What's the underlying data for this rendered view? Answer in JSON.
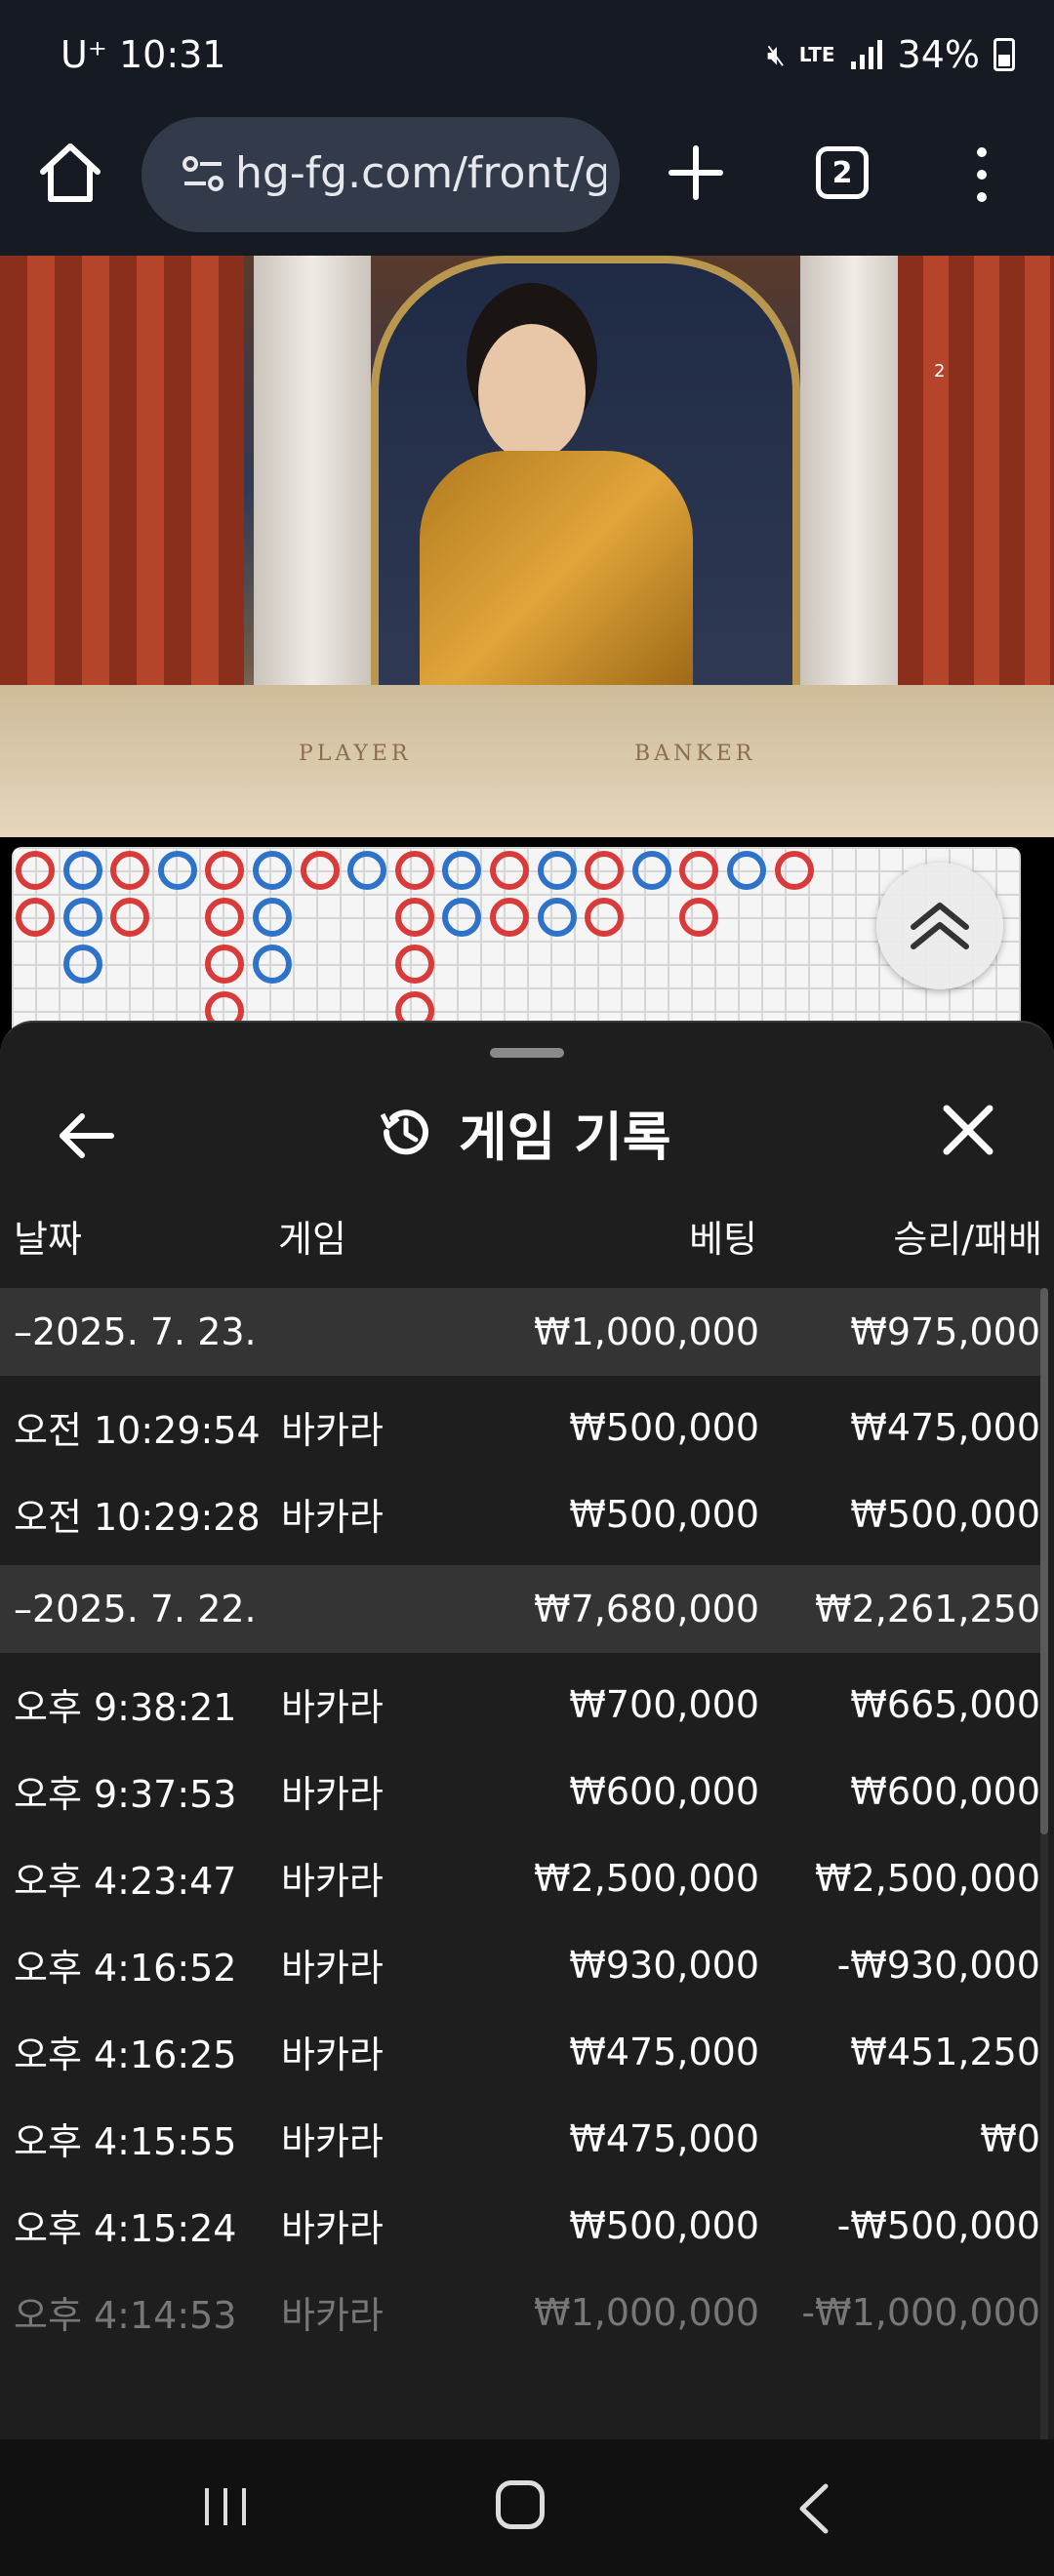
{
  "status_bar": {
    "carrier": "U⁺",
    "time": "10:31",
    "network": "LTE",
    "battery": "34%"
  },
  "browser": {
    "url": "hg-fg.com/front/g",
    "tab_count": "2"
  },
  "video": {
    "player_label": "PLAYER",
    "banker_label": "BANKER",
    "tag": "2"
  },
  "roadmap": {
    "beads": [
      {
        "col": 0,
        "row": 0,
        "color": "red"
      },
      {
        "col": 1,
        "row": 0,
        "color": "blue"
      },
      {
        "col": 2,
        "row": 0,
        "color": "red"
      },
      {
        "col": 3,
        "row": 0,
        "color": "blue"
      },
      {
        "col": 4,
        "row": 0,
        "color": "red"
      },
      {
        "col": 5,
        "row": 0,
        "color": "blue"
      },
      {
        "col": 6,
        "row": 0,
        "color": "red"
      },
      {
        "col": 7,
        "row": 0,
        "color": "blue"
      },
      {
        "col": 8,
        "row": 0,
        "color": "red"
      },
      {
        "col": 9,
        "row": 0,
        "color": "blue"
      },
      {
        "col": 10,
        "row": 0,
        "color": "red"
      },
      {
        "col": 11,
        "row": 0,
        "color": "blue"
      },
      {
        "col": 12,
        "row": 0,
        "color": "red"
      },
      {
        "col": 13,
        "row": 0,
        "color": "blue"
      },
      {
        "col": 14,
        "row": 0,
        "color": "red"
      },
      {
        "col": 15,
        "row": 0,
        "color": "blue"
      },
      {
        "col": 16,
        "row": 0,
        "color": "red"
      },
      {
        "col": 0,
        "row": 1,
        "color": "red"
      },
      {
        "col": 1,
        "row": 1,
        "color": "blue"
      },
      {
        "col": 2,
        "row": 1,
        "color": "red"
      },
      {
        "col": 4,
        "row": 1,
        "color": "red"
      },
      {
        "col": 5,
        "row": 1,
        "color": "blue"
      },
      {
        "col": 8,
        "row": 1,
        "color": "red"
      },
      {
        "col": 9,
        "row": 1,
        "color": "blue"
      },
      {
        "col": 10,
        "row": 1,
        "color": "red"
      },
      {
        "col": 11,
        "row": 1,
        "color": "blue"
      },
      {
        "col": 12,
        "row": 1,
        "color": "red"
      },
      {
        "col": 14,
        "row": 1,
        "color": "red"
      },
      {
        "col": 1,
        "row": 2,
        "color": "blue"
      },
      {
        "col": 4,
        "row": 2,
        "color": "red"
      },
      {
        "col": 5,
        "row": 2,
        "color": "blue"
      },
      {
        "col": 8,
        "row": 2,
        "color": "red"
      },
      {
        "col": 4,
        "row": 3,
        "color": "red"
      },
      {
        "col": 8,
        "row": 3,
        "color": "red"
      }
    ]
  },
  "sheet": {
    "title": "게임 기록",
    "columns": {
      "date": "날짜",
      "game": "게임",
      "bet": "베팅",
      "win_loss": "승리/패배"
    },
    "groups": [
      {
        "date": "–2025. 7. 23.",
        "bet": "₩1,000,000",
        "win_loss": "₩975,000",
        "rows": [
          {
            "time": "오전 10:29:54",
            "game": "바카라",
            "bet": "₩500,000",
            "win_loss": "₩475,000"
          },
          {
            "time": "오전 10:29:28",
            "game": "바카라",
            "bet": "₩500,000",
            "win_loss": "₩500,000"
          }
        ]
      },
      {
        "date": "–2025. 7. 22.",
        "bet": "₩7,680,000",
        "win_loss": "₩2,261,250",
        "rows": [
          {
            "time": "오후 9:38:21",
            "game": "바카라",
            "bet": "₩700,000",
            "win_loss": "₩665,000"
          },
          {
            "time": "오후 9:37:53",
            "game": "바카라",
            "bet": "₩600,000",
            "win_loss": "₩600,000"
          },
          {
            "time": "오후 4:23:47",
            "game": "바카라",
            "bet": "₩2,500,000",
            "win_loss": "₩2,500,000"
          },
          {
            "time": "오후 4:16:52",
            "game": "바카라",
            "bet": "₩930,000",
            "win_loss": "-₩930,000"
          },
          {
            "time": "오후 4:16:25",
            "game": "바카라",
            "bet": "₩475,000",
            "win_loss": "₩451,250"
          },
          {
            "time": "오후 4:15:55",
            "game": "바카라",
            "bet": "₩475,000",
            "win_loss": "₩0"
          },
          {
            "time": "오후 4:15:24",
            "game": "바카라",
            "bet": "₩500,000",
            "win_loss": "-₩500,000"
          },
          {
            "time": "오후 4:14:53",
            "game": "바카라",
            "bet": "₩1,000,000",
            "win_loss": "-₩1,000,000"
          }
        ]
      }
    ]
  }
}
